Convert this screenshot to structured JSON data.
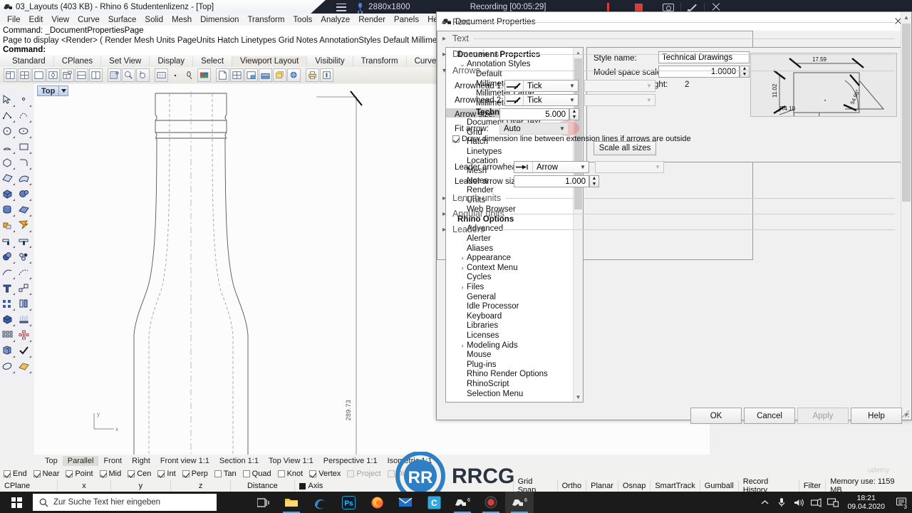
{
  "titlebar": {
    "title": "03_Layouts (403 KB) - Rhino 6 Studentenlizenz - [Top]",
    "icon": "rhino-icon"
  },
  "recording_bar": {
    "menu_icon": "hamburger-icon",
    "mic_icon": "microphone-icon",
    "resolution": "2880x1800",
    "status": "Recording [00:05:29]",
    "pause_icon": "pause-icon",
    "stop_icon": "stop-icon",
    "camera_icon": "camera-icon",
    "pen_icon": "pen-icon",
    "close_icon": "close-icon"
  },
  "menubar": {
    "items": [
      "File",
      "Edit",
      "View",
      "Curve",
      "Surface",
      "Solid",
      "Mesh",
      "Dimension",
      "Transform",
      "Tools",
      "Analyze",
      "Render",
      "Panels",
      "Help"
    ]
  },
  "command_area": {
    "line1": "Command: _DocumentPropertiesPage",
    "line2": "Page to display <Render> ( Render Mesh Units PageUnits Hatch Linetypes Grid Notes AnnotationStyles Default Millimete",
    "line3": "Command:"
  },
  "toolbar_tabs": {
    "items": [
      "Standard",
      "CPlanes",
      "Set View",
      "Display",
      "Select",
      "Viewport Layout",
      "Visibility",
      "Transform",
      "Curve Tools"
    ],
    "active": "Viewport Layout"
  },
  "viewport": {
    "label": "Top",
    "dropdown_icon": "chevron-down-icon",
    "dimension_value": "289.73",
    "axis_x": "x",
    "axis_y": "y"
  },
  "view_tabs": {
    "items": [
      "Top",
      "Parallel",
      "Front",
      "Right",
      "Front view 1:1",
      "Section 1:1",
      "Top View 1:1",
      "Perspective 1:1",
      "Isometric 1:1"
    ],
    "active": "Parallel"
  },
  "osnap": {
    "items": [
      {
        "label": "End",
        "checked": true,
        "enabled": true
      },
      {
        "label": "Near",
        "checked": true,
        "enabled": true
      },
      {
        "label": "Point",
        "checked": true,
        "enabled": true
      },
      {
        "label": "Mid",
        "checked": true,
        "enabled": true
      },
      {
        "label": "Cen",
        "checked": true,
        "enabled": true
      },
      {
        "label": "Int",
        "checked": true,
        "enabled": true
      },
      {
        "label": "Perp",
        "checked": true,
        "enabled": true
      },
      {
        "label": "Tan",
        "checked": false,
        "enabled": true
      },
      {
        "label": "Quad",
        "checked": false,
        "enabled": true
      },
      {
        "label": "Knot",
        "checked": false,
        "enabled": true
      },
      {
        "label": "Vertex",
        "checked": true,
        "enabled": true
      },
      {
        "label": "Project",
        "checked": false,
        "enabled": false
      },
      {
        "label": "Disable",
        "checked": false,
        "enabled": false
      }
    ]
  },
  "statusbar": {
    "cplane": "CPlane",
    "x": "x",
    "y": "y",
    "z": "z",
    "distance": "Distance",
    "axis": "Axis",
    "grid_snap": "Grid Snap",
    "ortho": "Ortho",
    "planar": "Planar",
    "osnap": "Osnap",
    "smarttrack": "SmartTrack",
    "gumball": "Gumball",
    "record_history": "Record History",
    "filter": "Filter",
    "memory": "Memory use: 1159 MB"
  },
  "dialog": {
    "title": "Document Properties",
    "icon": "rhino-icon",
    "close_icon": "close-icon",
    "tree": [
      {
        "label": "Document Properties",
        "level": 0,
        "bold": true,
        "twisty": ""
      },
      {
        "label": "Annotation Styles",
        "level": 1,
        "bold": false,
        "twisty": "expanded"
      },
      {
        "label": "Default",
        "level": 2,
        "bold": false,
        "twisty": ""
      },
      {
        "label": "Millimeter Architectural",
        "level": 2,
        "bold": false,
        "twisty": ""
      },
      {
        "label": "Millimeter Large",
        "level": 2,
        "bold": false,
        "twisty": ""
      },
      {
        "label": "Millimeter Small",
        "level": 2,
        "bold": false,
        "twisty": ""
      },
      {
        "label": "Technical Drawings",
        "level": 2,
        "bold": true,
        "selected": true,
        "twisty": ""
      },
      {
        "label": "Document User Text",
        "level": 1,
        "bold": false,
        "twisty": ""
      },
      {
        "label": "Grid",
        "level": 1,
        "bold": false,
        "twisty": ""
      },
      {
        "label": "Hatch",
        "level": 1,
        "bold": false,
        "twisty": ""
      },
      {
        "label": "Linetypes",
        "level": 1,
        "bold": false,
        "twisty": ""
      },
      {
        "label": "Location",
        "level": 1,
        "bold": false,
        "twisty": ""
      },
      {
        "label": "Mesh",
        "level": 1,
        "bold": false,
        "twisty": ""
      },
      {
        "label": "Notes",
        "level": 1,
        "bold": false,
        "twisty": ""
      },
      {
        "label": "Render",
        "level": 1,
        "bold": false,
        "twisty": ""
      },
      {
        "label": "Units",
        "level": 1,
        "bold": false,
        "twisty": "collapsed"
      },
      {
        "label": "Web Browser",
        "level": 1,
        "bold": false,
        "twisty": ""
      },
      {
        "label": "Rhino Options",
        "level": 0,
        "bold": true,
        "twisty": ""
      },
      {
        "label": "Advanced",
        "level": 1,
        "bold": false,
        "twisty": ""
      },
      {
        "label": "Alerter",
        "level": 1,
        "bold": false,
        "twisty": ""
      },
      {
        "label": "Aliases",
        "level": 1,
        "bold": false,
        "twisty": ""
      },
      {
        "label": "Appearance",
        "level": 1,
        "bold": false,
        "twisty": "collapsed"
      },
      {
        "label": "Context Menu",
        "level": 1,
        "bold": false,
        "twisty": "collapsed"
      },
      {
        "label": "Cycles",
        "level": 1,
        "bold": false,
        "twisty": ""
      },
      {
        "label": "Files",
        "level": 1,
        "bold": false,
        "twisty": "collapsed"
      },
      {
        "label": "General",
        "level": 1,
        "bold": false,
        "twisty": ""
      },
      {
        "label": "Idle Processor",
        "level": 1,
        "bold": false,
        "twisty": ""
      },
      {
        "label": "Keyboard",
        "level": 1,
        "bold": false,
        "twisty": ""
      },
      {
        "label": "Libraries",
        "level": 1,
        "bold": false,
        "twisty": ""
      },
      {
        "label": "Licenses",
        "level": 1,
        "bold": false,
        "twisty": ""
      },
      {
        "label": "Modeling Aids",
        "level": 1,
        "bold": false,
        "twisty": "collapsed"
      },
      {
        "label": "Mouse",
        "level": 1,
        "bold": false,
        "twisty": ""
      },
      {
        "label": "Plug-ins",
        "level": 1,
        "bold": false,
        "twisty": ""
      },
      {
        "label": "Rhino Render Options",
        "level": 1,
        "bold": false,
        "twisty": ""
      },
      {
        "label": "RhinoScript",
        "level": 1,
        "bold": false,
        "twisty": ""
      },
      {
        "label": "Selection Menu",
        "level": 1,
        "bold": false,
        "twisty": ""
      }
    ],
    "style": {
      "style_name_label": "Style name:",
      "style_name_value": "Technical Drawings",
      "model_space_scale_label": "Model space scale:",
      "model_space_scale_value": "1.0000",
      "adjusted_text_height_label": "Adjusted text height:",
      "adjusted_text_height_value": "2",
      "scale_all_sizes_button": "Scale all sizes",
      "preview_dims": {
        "width": "17.59",
        "height": "11.02",
        "angle": "54.98°",
        "radius": "R4.10"
      }
    },
    "sections": [
      {
        "label": "Font",
        "expanded": false
      },
      {
        "label": "Text",
        "expanded": false
      },
      {
        "label": "Dimensions",
        "expanded": false
      },
      {
        "label": "Arrows",
        "expanded": true
      },
      {
        "label": "Length units",
        "expanded": false
      },
      {
        "label": "Angular units",
        "expanded": false
      },
      {
        "label": "Leaders",
        "expanded": false
      }
    ],
    "arrows": {
      "arrowhead1_label": "Arrowhead 1:",
      "arrowhead1_value": "Tick",
      "arrowhead2_label": "Arrowhead 2:",
      "arrowhead2_value": "Tick",
      "arrow_size_label": "Arrow size:",
      "arrow_size_value": "5.000",
      "fit_arrow_label": "Fit arrow:",
      "fit_arrow_value": "Auto",
      "draw_dim_line_label": "Draw dimension line between extension lines if arrows are outside",
      "draw_dim_line_checked": true,
      "leader_arrowhead_label": "Leader arrowhead:",
      "leader_arrowhead_value": "Arrow",
      "leader_arrow_size_label": "Leader arrow size:",
      "leader_arrow_size_value": "1.000"
    },
    "footer": {
      "ok": "OK",
      "cancel": "Cancel",
      "apply": "Apply",
      "help": "Help"
    }
  },
  "taskbar": {
    "start_icon": "windows-logo-icon",
    "search_placeholder": "Zur Suche Text hier eingeben",
    "search_icon": "search-icon",
    "apps": [
      {
        "name": "task-view-icon"
      },
      {
        "name": "file-explorer-icon"
      },
      {
        "name": "edge-icon"
      },
      {
        "name": "photoshop-icon",
        "label": "Ps"
      },
      {
        "name": "firefox-icon"
      },
      {
        "name": "mail-icon"
      },
      {
        "name": "camtasia-icon",
        "label": "C"
      },
      {
        "name": "rhino-icon",
        "label": "6"
      },
      {
        "name": "recorder-icon"
      },
      {
        "name": "rhino-icon-2",
        "label": "6"
      }
    ],
    "tray": {
      "chevron_icon": "chevron-up-icon",
      "mic_icon": "microphone-icon",
      "volume_icon": "volume-icon",
      "network_icon": "network-icon",
      "display_icon": "display-icon",
      "time": "18:21",
      "date": "09.04.2020",
      "notification_icon": "notification-icon",
      "notification_count": "3"
    }
  },
  "watermarks": {
    "rrcg": "RRCG",
    "udemy": "udemy"
  },
  "colors": {
    "accent_blue": "#4aa3e8",
    "record_red": "#e03b3b",
    "dialog_bg": "#f0f0f0",
    "halo": "#e87878"
  }
}
